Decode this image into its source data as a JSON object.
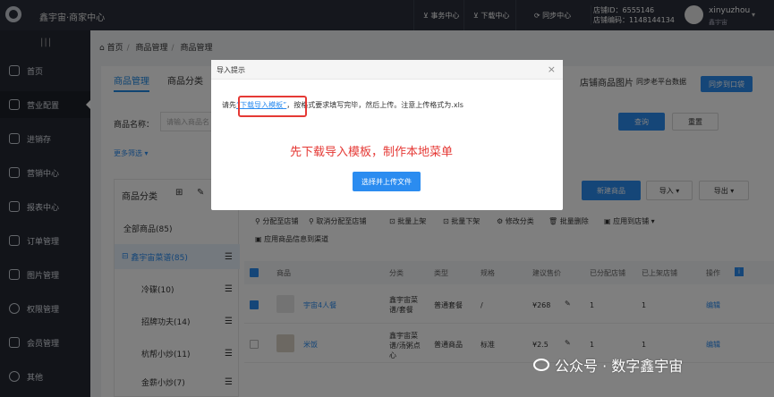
{
  "topbar": {
    "brand": "鑫宇宙·商家中心",
    "nav": [
      "事务中心",
      "下载中心",
      "同步中心"
    ],
    "store_id": "店铺ID：6555146",
    "store_code": "店铺编码：1148144134",
    "username": "xinyuzhou",
    "user_sub": "鑫宇宙"
  },
  "sidebar": {
    "items": [
      "首页",
      "营业配置",
      "进销存",
      "营销中心",
      "报表中心",
      "订单管理",
      "图片管理",
      "权限管理",
      "会员管理",
      "其他"
    ]
  },
  "breadcrumb": [
    "首页",
    "商品管理",
    "商品管理"
  ],
  "tabs": [
    "商品管理",
    "商品分类"
  ],
  "tab_right": {
    "title": "店铺商品图片",
    "sync_old": "同步老平台数据",
    "sync_btn": "同步到口袋"
  },
  "filter": {
    "name_label": "商品名称：",
    "name_placeholder": "请输入商品名",
    "query": "查询",
    "reset": "重置",
    "more": "更多筛选"
  },
  "category": {
    "title": "商品分类",
    "items": [
      {
        "label": "全部商品(85)"
      },
      {
        "label": "鑫宇宙菜谱(85)"
      },
      {
        "label": "冷碟(10)"
      },
      {
        "label": "招牌功夫(14)"
      },
      {
        "label": "杭帮小炒(11)"
      },
      {
        "label": "金薪小炒(7)"
      }
    ]
  },
  "actions": {
    "new": "新建商品",
    "import": "导入",
    "export": "导出"
  },
  "toolbar": [
    "分配至店铺",
    "取消分配至店铺",
    "批量上架",
    "批量下架",
    "修改分类",
    "批量删除",
    "应用到店铺",
    "应用商品信息到渠道"
  ],
  "table": {
    "headers": [
      "商品",
      "分类",
      "类型",
      "规格",
      "建议售价",
      "已分配店铺",
      "已上架店铺",
      "操作"
    ],
    "rows": [
      {
        "name": "宇宙4人餐",
        "category": "鑫宇宙菜谱/套餐",
        "type": "普通套餐",
        "spec": "/",
        "price": "¥268",
        "assigned": "1",
        "listed": "1",
        "op": "编辑"
      },
      {
        "name": "米饭",
        "category": "鑫宇宙菜谱/汤粥点心",
        "type": "普通商品",
        "spec": "标准",
        "price": "¥2.5",
        "assigned": "1",
        "listed": "1",
        "op": "编辑"
      }
    ]
  },
  "modal": {
    "title": "导入提示",
    "text_prefix": "请先",
    "link": "“下载导入模板”",
    "text_suffix": "，按格式要求填写完毕，然后上传。注意上传格式为.xls",
    "note": "先下载导入模板，制作本地菜单",
    "upload": "选择并上传文件",
    "close": "×"
  },
  "watermark": "公众号 · 数字鑫宇宙",
  "colors": {
    "primary": "#2b8cf0",
    "highlight": "#e53935",
    "topbar": "#2a2f3b",
    "sidebar": "#242933"
  }
}
